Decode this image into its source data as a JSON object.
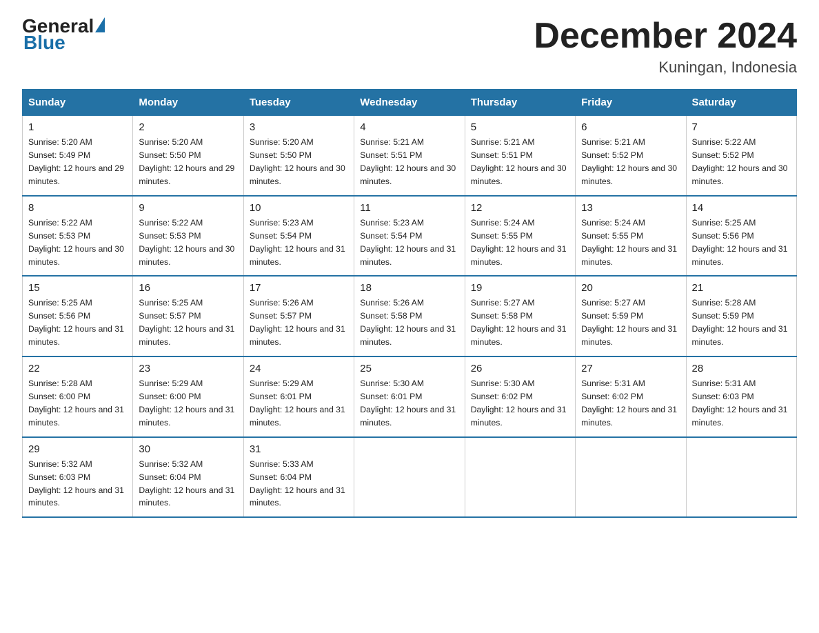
{
  "logo": {
    "general": "General",
    "blue": "Blue"
  },
  "header": {
    "title": "December 2024",
    "location": "Kuningan, Indonesia"
  },
  "days_of_week": [
    "Sunday",
    "Monday",
    "Tuesday",
    "Wednesday",
    "Thursday",
    "Friday",
    "Saturday"
  ],
  "weeks": [
    [
      {
        "day": "1",
        "sunrise": "5:20 AM",
        "sunset": "5:49 PM",
        "daylight": "12 hours and 29 minutes."
      },
      {
        "day": "2",
        "sunrise": "5:20 AM",
        "sunset": "5:50 PM",
        "daylight": "12 hours and 29 minutes."
      },
      {
        "day": "3",
        "sunrise": "5:20 AM",
        "sunset": "5:50 PM",
        "daylight": "12 hours and 30 minutes."
      },
      {
        "day": "4",
        "sunrise": "5:21 AM",
        "sunset": "5:51 PM",
        "daylight": "12 hours and 30 minutes."
      },
      {
        "day": "5",
        "sunrise": "5:21 AM",
        "sunset": "5:51 PM",
        "daylight": "12 hours and 30 minutes."
      },
      {
        "day": "6",
        "sunrise": "5:21 AM",
        "sunset": "5:52 PM",
        "daylight": "12 hours and 30 minutes."
      },
      {
        "day": "7",
        "sunrise": "5:22 AM",
        "sunset": "5:52 PM",
        "daylight": "12 hours and 30 minutes."
      }
    ],
    [
      {
        "day": "8",
        "sunrise": "5:22 AM",
        "sunset": "5:53 PM",
        "daylight": "12 hours and 30 minutes."
      },
      {
        "day": "9",
        "sunrise": "5:22 AM",
        "sunset": "5:53 PM",
        "daylight": "12 hours and 30 minutes."
      },
      {
        "day": "10",
        "sunrise": "5:23 AM",
        "sunset": "5:54 PM",
        "daylight": "12 hours and 31 minutes."
      },
      {
        "day": "11",
        "sunrise": "5:23 AM",
        "sunset": "5:54 PM",
        "daylight": "12 hours and 31 minutes."
      },
      {
        "day": "12",
        "sunrise": "5:24 AM",
        "sunset": "5:55 PM",
        "daylight": "12 hours and 31 minutes."
      },
      {
        "day": "13",
        "sunrise": "5:24 AM",
        "sunset": "5:55 PM",
        "daylight": "12 hours and 31 minutes."
      },
      {
        "day": "14",
        "sunrise": "5:25 AM",
        "sunset": "5:56 PM",
        "daylight": "12 hours and 31 minutes."
      }
    ],
    [
      {
        "day": "15",
        "sunrise": "5:25 AM",
        "sunset": "5:56 PM",
        "daylight": "12 hours and 31 minutes."
      },
      {
        "day": "16",
        "sunrise": "5:25 AM",
        "sunset": "5:57 PM",
        "daylight": "12 hours and 31 minutes."
      },
      {
        "day": "17",
        "sunrise": "5:26 AM",
        "sunset": "5:57 PM",
        "daylight": "12 hours and 31 minutes."
      },
      {
        "day": "18",
        "sunrise": "5:26 AM",
        "sunset": "5:58 PM",
        "daylight": "12 hours and 31 minutes."
      },
      {
        "day": "19",
        "sunrise": "5:27 AM",
        "sunset": "5:58 PM",
        "daylight": "12 hours and 31 minutes."
      },
      {
        "day": "20",
        "sunrise": "5:27 AM",
        "sunset": "5:59 PM",
        "daylight": "12 hours and 31 minutes."
      },
      {
        "day": "21",
        "sunrise": "5:28 AM",
        "sunset": "5:59 PM",
        "daylight": "12 hours and 31 minutes."
      }
    ],
    [
      {
        "day": "22",
        "sunrise": "5:28 AM",
        "sunset": "6:00 PM",
        "daylight": "12 hours and 31 minutes."
      },
      {
        "day": "23",
        "sunrise": "5:29 AM",
        "sunset": "6:00 PM",
        "daylight": "12 hours and 31 minutes."
      },
      {
        "day": "24",
        "sunrise": "5:29 AM",
        "sunset": "6:01 PM",
        "daylight": "12 hours and 31 minutes."
      },
      {
        "day": "25",
        "sunrise": "5:30 AM",
        "sunset": "6:01 PM",
        "daylight": "12 hours and 31 minutes."
      },
      {
        "day": "26",
        "sunrise": "5:30 AM",
        "sunset": "6:02 PM",
        "daylight": "12 hours and 31 minutes."
      },
      {
        "day": "27",
        "sunrise": "5:31 AM",
        "sunset": "6:02 PM",
        "daylight": "12 hours and 31 minutes."
      },
      {
        "day": "28",
        "sunrise": "5:31 AM",
        "sunset": "6:03 PM",
        "daylight": "12 hours and 31 minutes."
      }
    ],
    [
      {
        "day": "29",
        "sunrise": "5:32 AM",
        "sunset": "6:03 PM",
        "daylight": "12 hours and 31 minutes."
      },
      {
        "day": "30",
        "sunrise": "5:32 AM",
        "sunset": "6:04 PM",
        "daylight": "12 hours and 31 minutes."
      },
      {
        "day": "31",
        "sunrise": "5:33 AM",
        "sunset": "6:04 PM",
        "daylight": "12 hours and 31 minutes."
      },
      null,
      null,
      null,
      null
    ]
  ]
}
